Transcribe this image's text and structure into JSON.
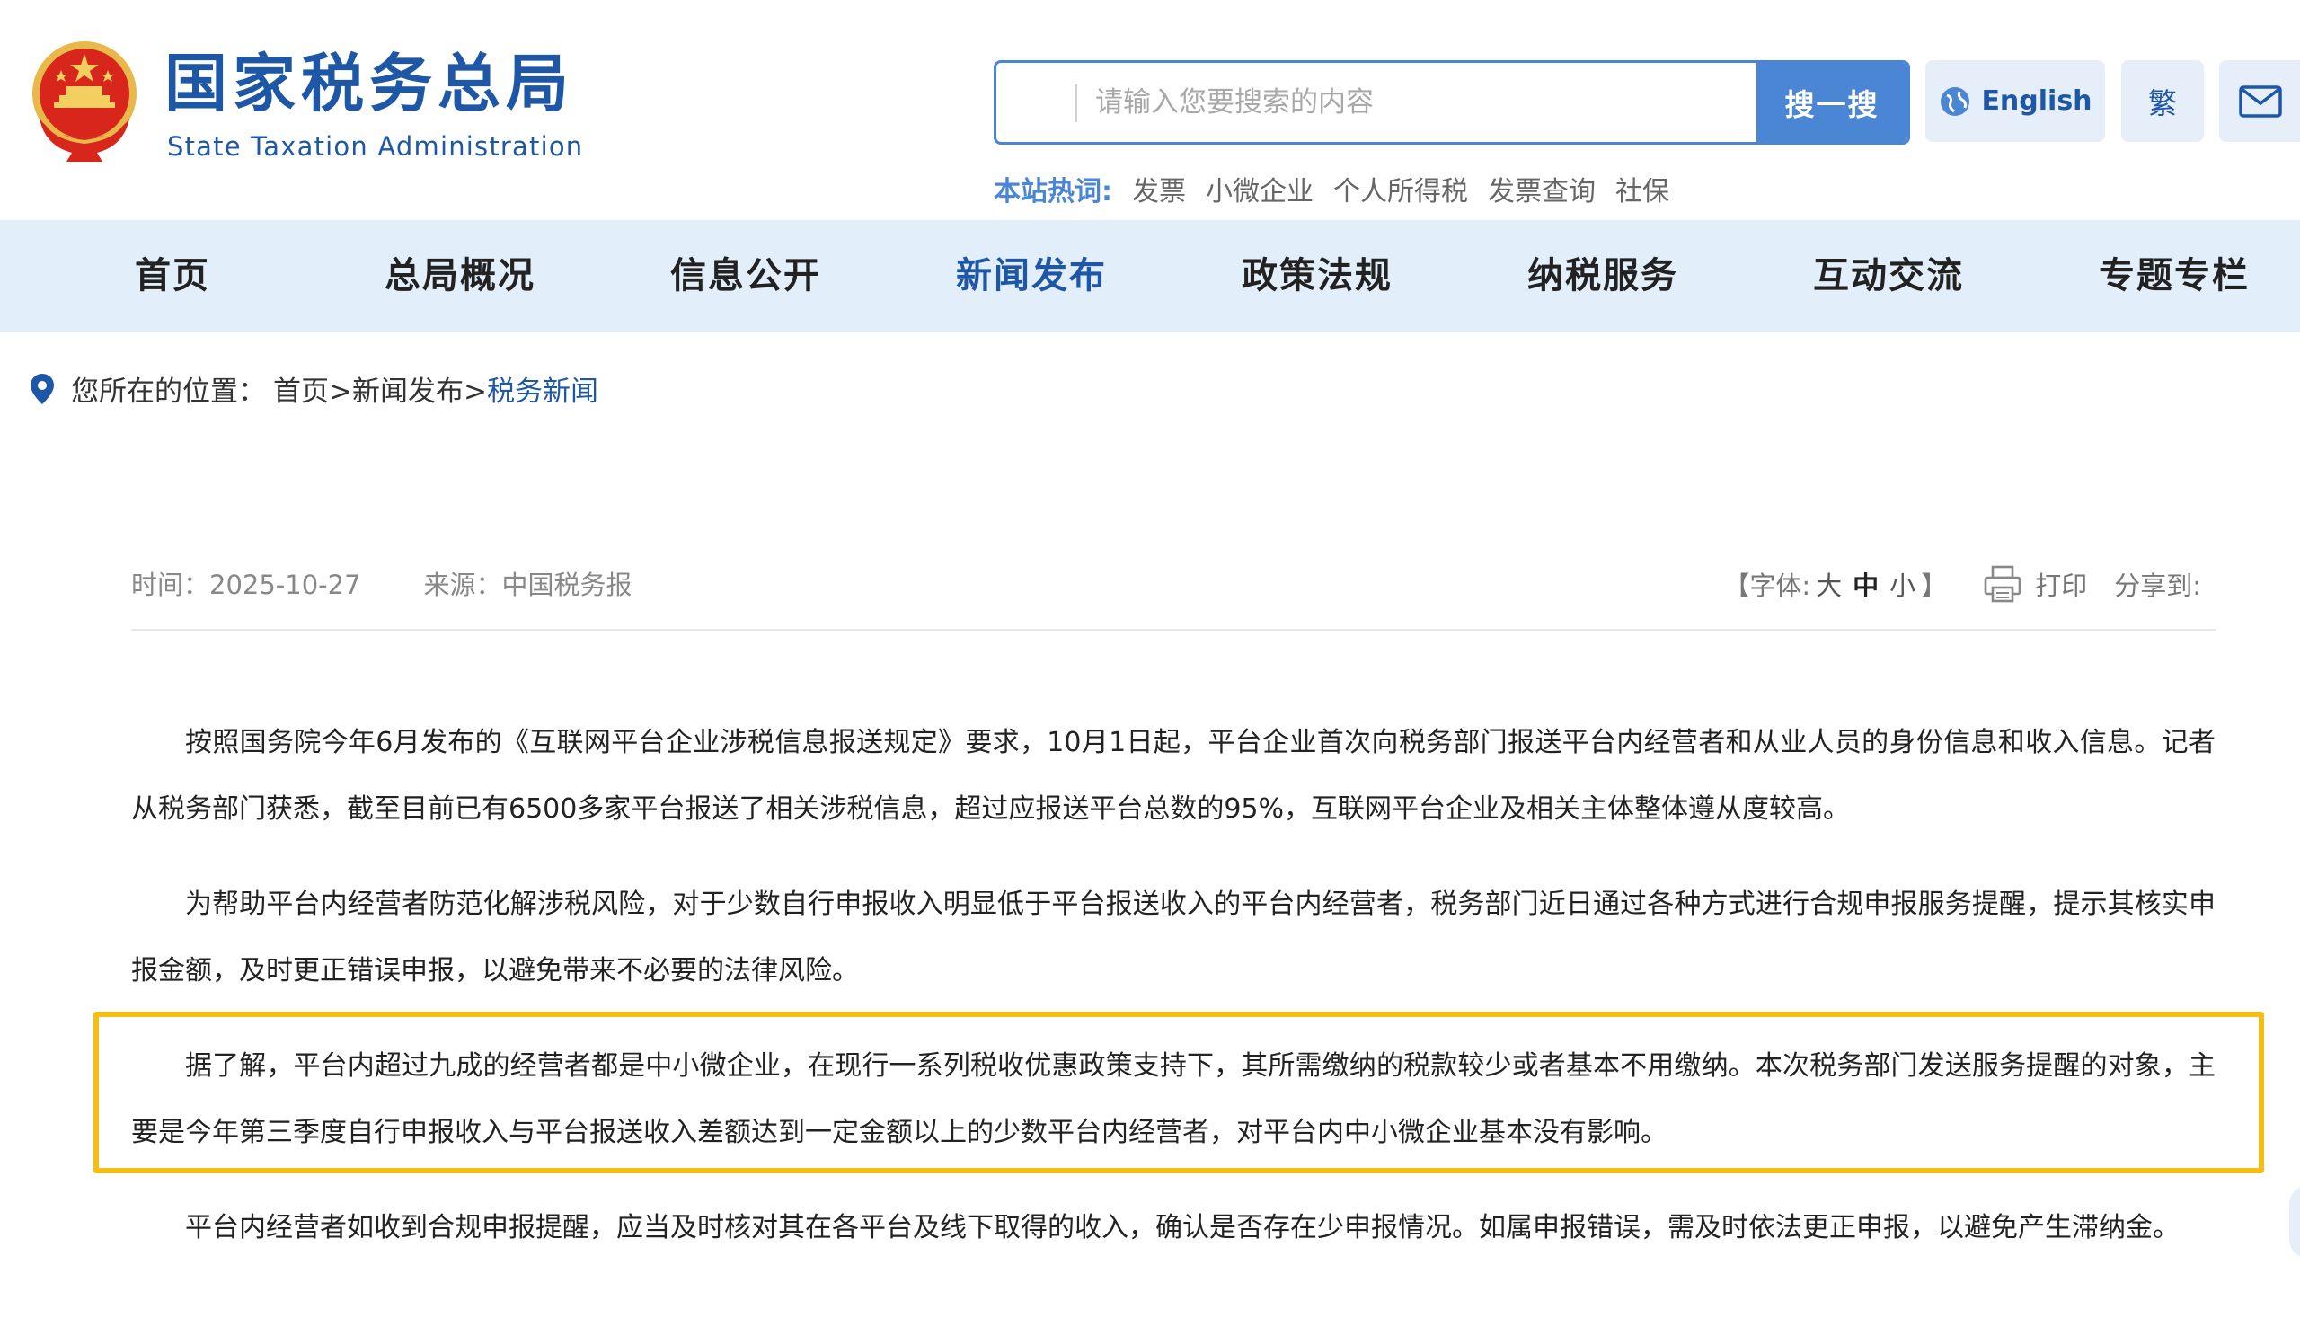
{
  "brand": {
    "name_cn": "国家税务总局",
    "name_en": "State Taxation Administration",
    "emblem_icon": "national-emblem-icon"
  },
  "search": {
    "placeholder": "请输入您要搜索的内容",
    "button_label": "搜一搜"
  },
  "top_links": {
    "english_label": "English",
    "traditional_label": "繁",
    "mail_icon": "mail-icon",
    "globe_icon": "globe-icon"
  },
  "hotwords": {
    "label": "本站热词:",
    "items": [
      "发票",
      "小微企业",
      "个人所得税",
      "发票查询",
      "社保"
    ]
  },
  "nav": {
    "items": [
      {
        "label": "首页"
      },
      {
        "label": "总局概况"
      },
      {
        "label": "信息公开"
      },
      {
        "label": "新闻发布",
        "active": true
      },
      {
        "label": "政策法规"
      },
      {
        "label": "纳税服务"
      },
      {
        "label": "互动交流"
      },
      {
        "label": "专题专栏"
      }
    ]
  },
  "breadcrumb": {
    "prefix": "您所在的位置：",
    "path": "首页>新闻发布>",
    "current": "税务新闻"
  },
  "meta": {
    "time": "时间：2025-10-27",
    "source": "来源：中国税务报",
    "font_label_open": "【字体: ",
    "font_large": "大",
    "font_medium": "中",
    "font_small": "小",
    "font_label_close": " 】",
    "print_label": "打印",
    "share_label": "分享到:"
  },
  "article": {
    "paragraphs": [
      "按照国务院今年6月发布的《互联网平台企业涉税信息报送规定》要求，10月1日起，平台企业首次向税务部门报送平台内经营者和从业人员的身份信息和收入信息。记者从税务部门获悉，截至目前已有6500多家平台报送了相关涉税信息，超过应报送平台总数的95%，互联网平台企业及相关主体整体遵从度较高。",
      "为帮助平台内经营者防范化解涉税风险，对于少数自行申报收入明显低于平台报送收入的平台内经营者，税务部门近日通过各种方式进行合规申报服务提醒，提示其核实申报金额，及时更正错误申报，以避免带来不必要的法律风险。",
      "据了解，平台内超过九成的经营者都是中小微企业，在现行一系列税收优惠政策支持下，其所需缴纳的税款较少或者基本不用缴纳。本次税务部门发送服务提醒的对象，主要是今年第三季度自行申报收入与平台报送收入差额达到一定金额以上的少数平台内经营者，对平台内中小微企业基本没有影响。",
      "平台内经营者如收到合规申报提醒，应当及时核对其在各平台及线下取得的收入，确认是否存在少申报情况。如属申报错误，需及时依法更正申报，以避免产生滞纳金。"
    ],
    "highlight_color": "#f6bd16"
  },
  "colors": {
    "brand_blue": "#1f57a7",
    "accent_blue": "#4a86d4",
    "nav_bg": "#e3eefb"
  }
}
